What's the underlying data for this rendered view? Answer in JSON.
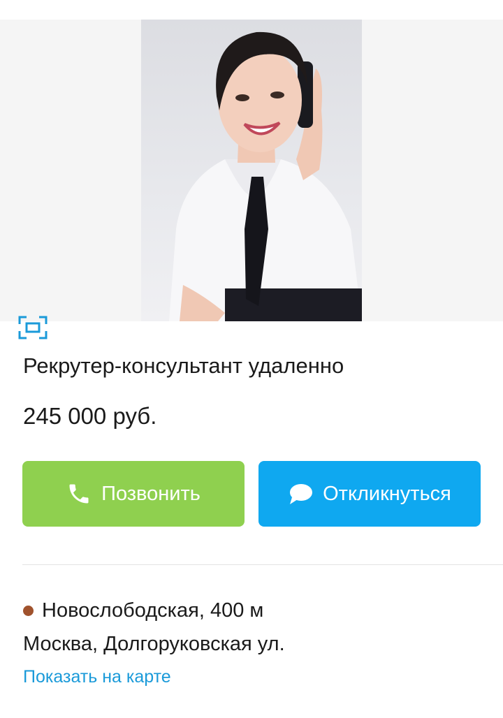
{
  "listing": {
    "title": "Рекрутер-консультант удаленно",
    "price": "245 000 руб.",
    "photo_icon": "fullscreen-icon"
  },
  "actions": {
    "call_label": "Позвонить",
    "call_icon": "phone-icon",
    "reply_label": "Откликнуться",
    "reply_icon": "chat-bubble-icon"
  },
  "location": {
    "metro_station": "Новослободская, 400 м",
    "metro_color": "#a0522d",
    "address": "Москва, Долгоруковская ул.",
    "map_link": "Показать на карте"
  },
  "colors": {
    "call_button": "#8fd04f",
    "reply_button": "#0fa8f0",
    "link": "#1a9ad9"
  }
}
